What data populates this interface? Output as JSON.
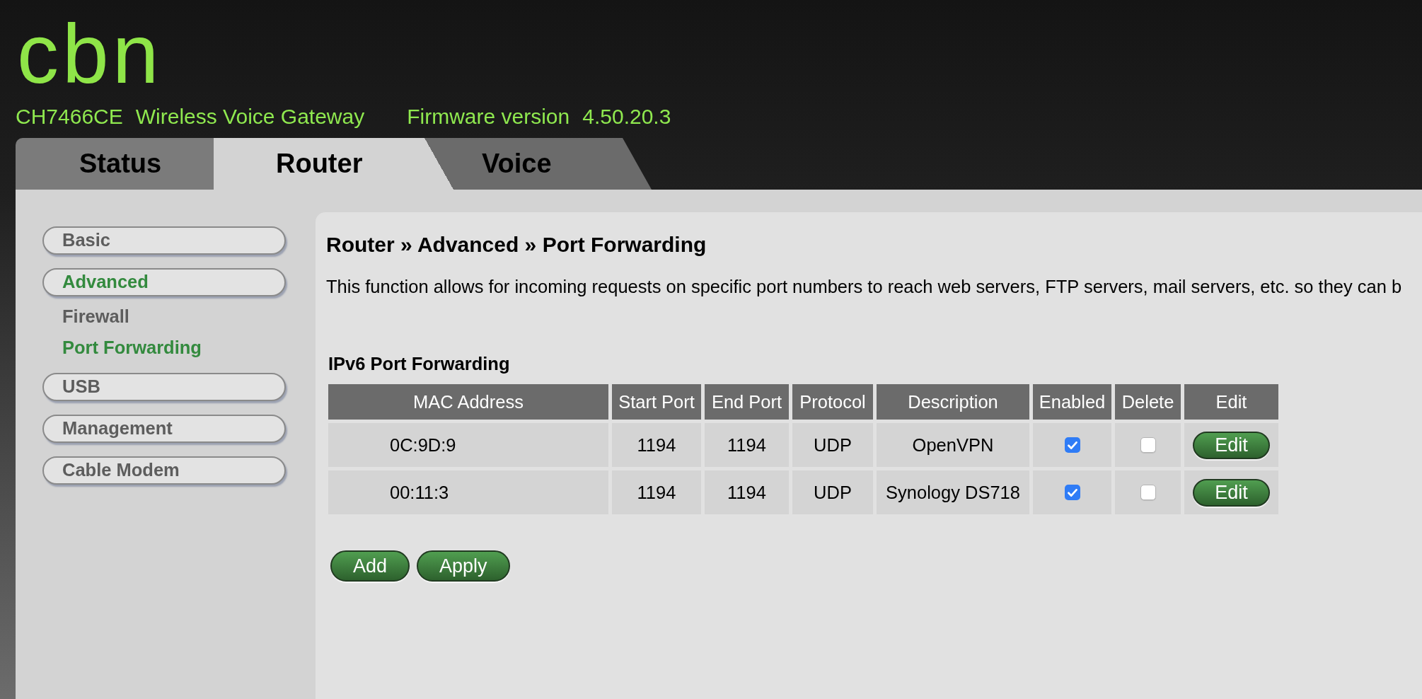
{
  "logo": "cbn",
  "header": {
    "model": "CH7466CE",
    "product": "Wireless Voice Gateway",
    "firmware_label": "Firmware version",
    "firmware_version": "4.50.20.3"
  },
  "tabs": [
    {
      "label": "Status",
      "selected": false
    },
    {
      "label": "Router",
      "selected": true
    },
    {
      "label": "Voice",
      "selected": false
    }
  ],
  "sidebar": {
    "items": [
      {
        "label": "Basic",
        "selected": false
      },
      {
        "label": "Advanced",
        "selected": true,
        "children": [
          {
            "label": "Firewall",
            "selected": false
          },
          {
            "label": "Port Forwarding",
            "selected": true
          }
        ]
      },
      {
        "label": "USB",
        "selected": false
      },
      {
        "label": "Management",
        "selected": false
      },
      {
        "label": "Cable Modem",
        "selected": false
      }
    ]
  },
  "breadcrumb": "Router » Advanced » Port Forwarding",
  "description": "This function allows for incoming requests on specific port numbers to reach web servers, FTP servers, mail servers, etc. so they can b",
  "section": {
    "title": "IPv6 Port Forwarding",
    "table": {
      "columns": [
        "MAC Address",
        "Start Port",
        "End Port",
        "Protocol",
        "Description",
        "Enabled",
        "Delete",
        "Edit"
      ],
      "rows": [
        {
          "mac_address": "0C:9D:9",
          "start_port": "1194",
          "end_port": "1194",
          "protocol": "UDP",
          "description": "OpenVPN",
          "enabled": true,
          "delete": false,
          "edit": "Edit"
        },
        {
          "mac_address": "00:11:3",
          "start_port": "1194",
          "end_port": "1194",
          "protocol": "UDP",
          "description": "Synology DS718",
          "enabled": true,
          "delete": false,
          "edit": "Edit"
        }
      ]
    }
  },
  "buttons": [
    "Add",
    "Apply"
  ]
}
